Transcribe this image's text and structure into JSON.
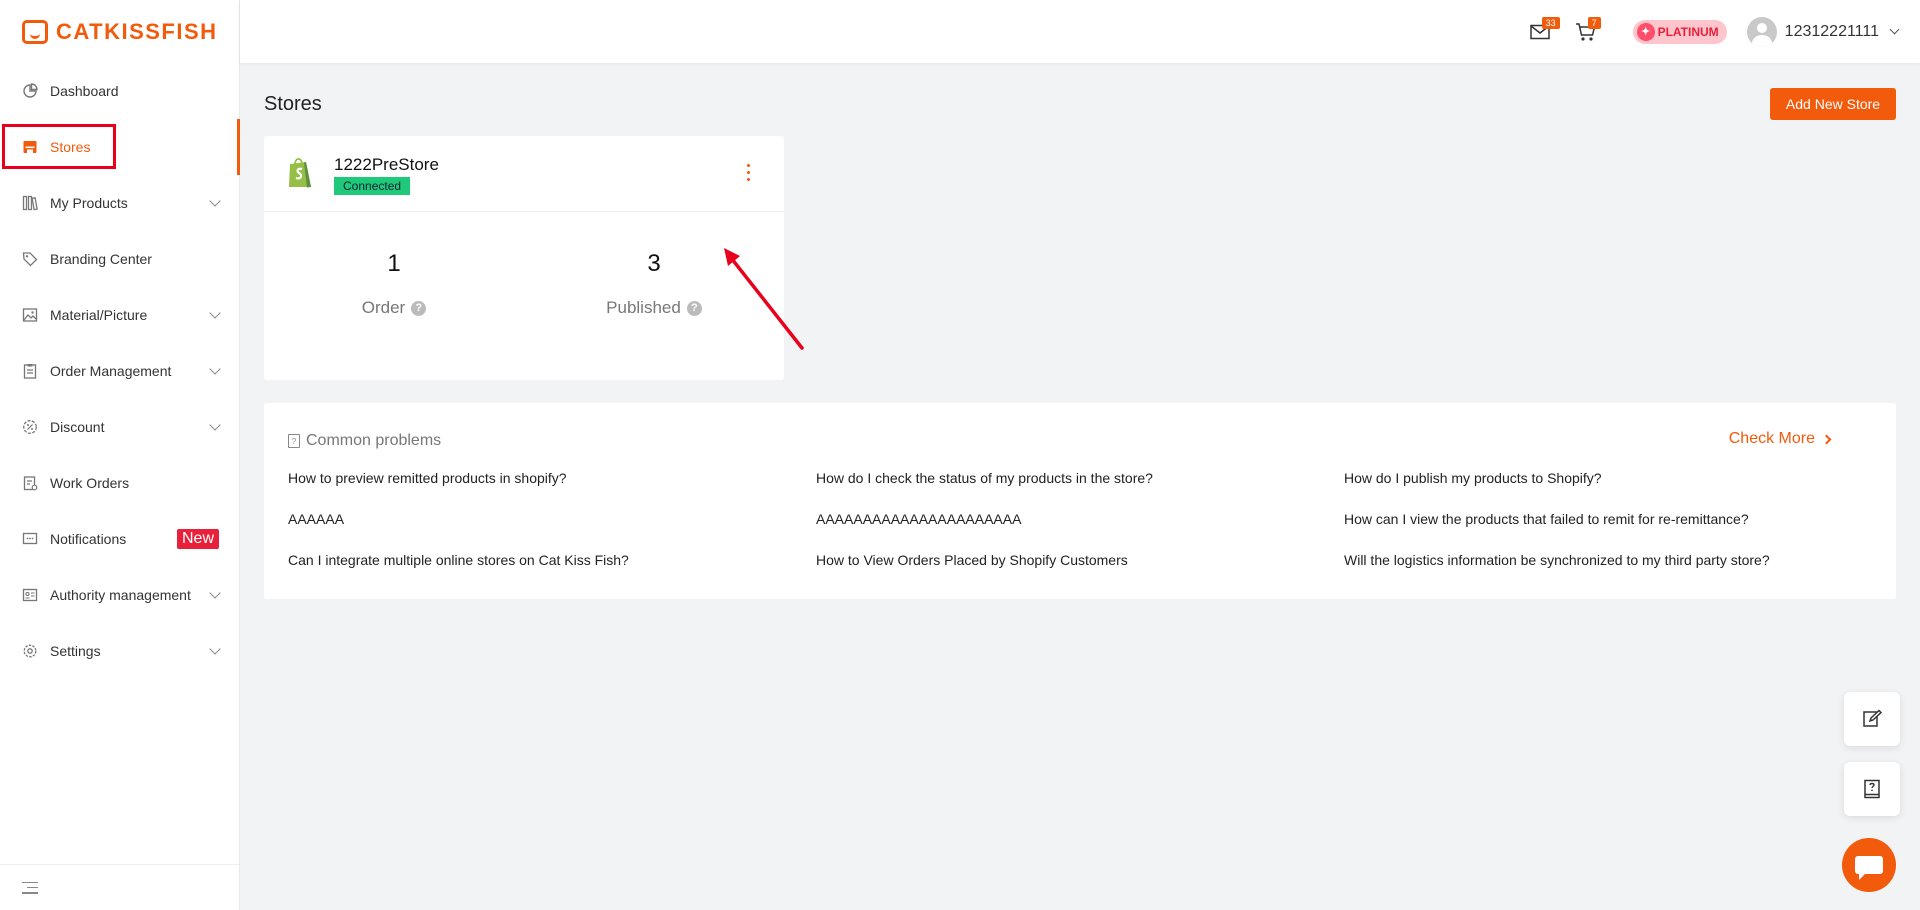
{
  "app": {
    "brand": "CATKISSFISH"
  },
  "sidebar": {
    "items": [
      {
        "label": "Dashboard"
      },
      {
        "label": "Stores"
      },
      {
        "label": "My Products"
      },
      {
        "label": "Branding Center"
      },
      {
        "label": "Material/Picture"
      },
      {
        "label": "Order Management"
      },
      {
        "label": "Discount"
      },
      {
        "label": "Work Orders"
      },
      {
        "label": "Notifications",
        "badge": "New"
      },
      {
        "label": "Authority management"
      },
      {
        "label": "Settings"
      }
    ],
    "active": "Stores"
  },
  "header": {
    "mail_count": "33",
    "cart_count": "7",
    "membership": "PLATINUM",
    "username": "12312221111"
  },
  "main": {
    "title": "Stores",
    "add_button": "Add New Store",
    "store": {
      "name": "1222PreStore",
      "status": "Connected",
      "platform_icon": "shopify-icon",
      "stats": [
        {
          "value": "1",
          "label": "Order"
        },
        {
          "value": "3",
          "label": "Published"
        }
      ]
    },
    "problems": {
      "title": "Common problems",
      "check_more": "Check More",
      "questions": [
        "How to preview remitted products in shopify?",
        "How do I check the status of my products in the store?",
        "How do I publish my products to Shopify?",
        "AAAAAA",
        "AAAAAAAAAAAAAAAAAAAAAA",
        "How can I view the products that failed to remit for re-remittance?",
        "Can I integrate multiple online stores on Cat Kiss Fish?",
        "How to View Orders Placed by Shopify Customers",
        "Will the logistics information be synchronized to my third party store?"
      ]
    }
  },
  "colors": {
    "accent": "#f25a0c",
    "connected": "#1fc97a",
    "annotation": "#e8001c"
  }
}
